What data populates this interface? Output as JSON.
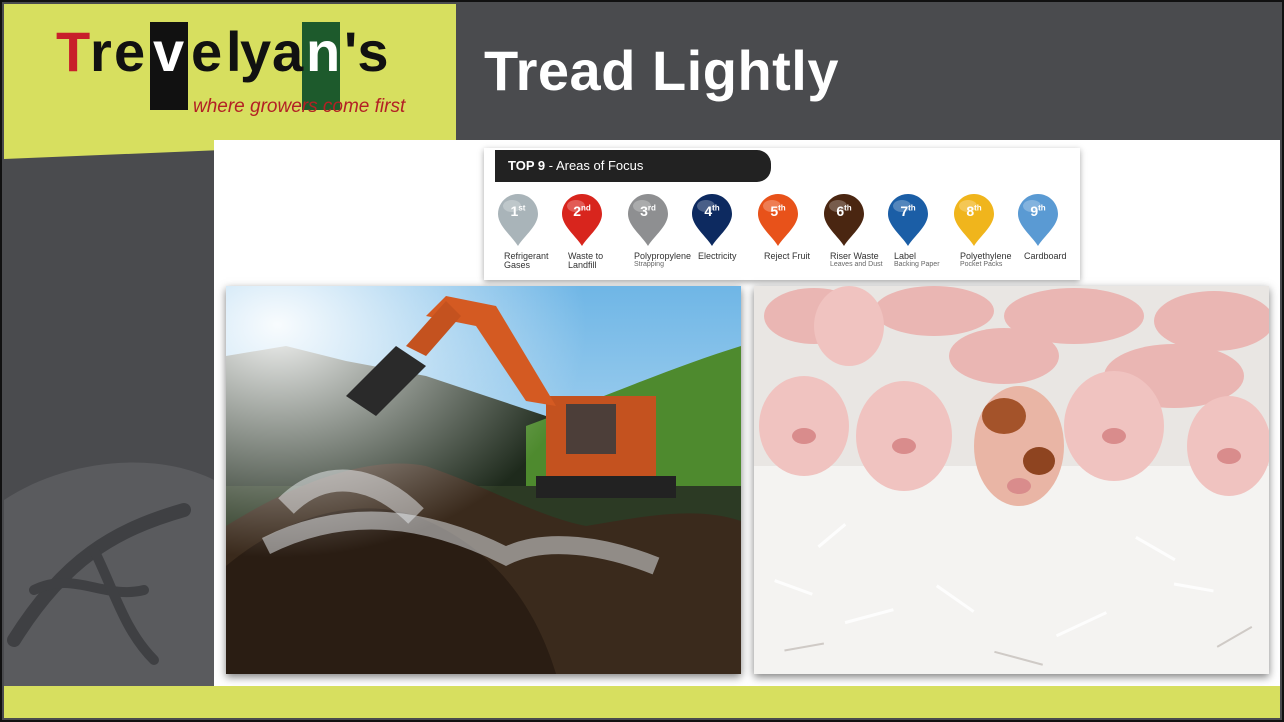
{
  "slide": {
    "title": "Tread Lightly"
  },
  "logo": {
    "letters": [
      "T",
      "r",
      "e",
      "v",
      "e",
      "l",
      "y",
      "a",
      "n",
      "'s"
    ],
    "tagline": "where growers come first",
    "brand_colors": {
      "red": "#c8202a",
      "green": "#1d5a2c",
      "black": "#111111",
      "lime": "#d7df5f"
    }
  },
  "focus_panel": {
    "heading_bold": "TOP 9",
    "heading_rest": " - Areas of Focus",
    "items": [
      {
        "rank_num": "1",
        "rank_suffix": "st",
        "label": "Refrigerant Gases",
        "sub": "",
        "color": "#a9b4b9"
      },
      {
        "rank_num": "2",
        "rank_suffix": "nd",
        "label": "Waste to Landfill",
        "sub": "",
        "color": "#d8251d"
      },
      {
        "rank_num": "3",
        "rank_suffix": "rd",
        "label": "Polypropylene",
        "sub": "Strapping",
        "color": "#8e8f91"
      },
      {
        "rank_num": "4",
        "rank_suffix": "th",
        "label": "Electricity",
        "sub": "",
        "color": "#0d2a60"
      },
      {
        "rank_num": "5",
        "rank_suffix": "th",
        "label": "Reject Fruit",
        "sub": "",
        "color": "#e8521a"
      },
      {
        "rank_num": "6",
        "rank_suffix": "th",
        "label": "Riser Waste",
        "sub": "Leaves and Dust",
        "color": "#4a2611"
      },
      {
        "rank_num": "7",
        "rank_suffix": "th",
        "label": "Label",
        "sub": "Backing Paper",
        "color": "#1b5ea6"
      },
      {
        "rank_num": "8",
        "rank_suffix": "th",
        "label": "Polyethylene",
        "sub": "Pocket Packs",
        "color": "#f0b51c"
      },
      {
        "rank_num": "9",
        "rank_suffix": "th",
        "label": "Cardboard",
        "sub": "",
        "color": "#5a9ad3"
      }
    ]
  },
  "photos": {
    "left": {
      "alt": "excavator-compost"
    },
    "right": {
      "alt": "piglets-on-shredded-paper"
    }
  }
}
